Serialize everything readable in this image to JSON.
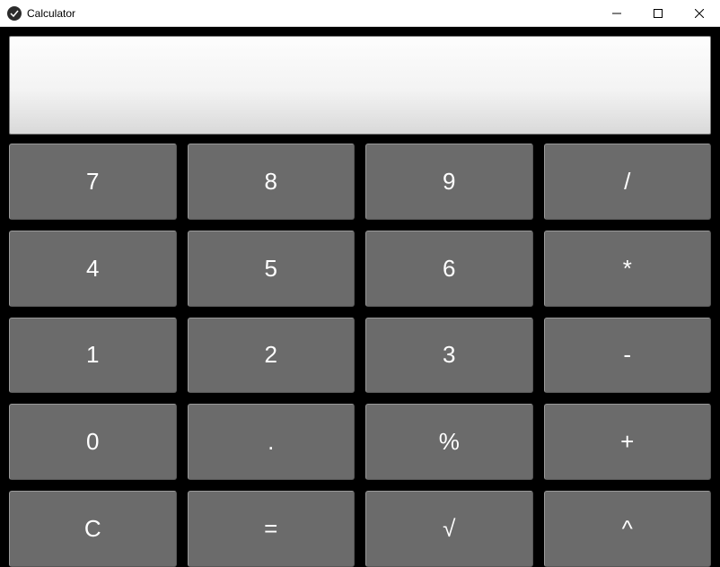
{
  "window": {
    "title": "Calculator"
  },
  "display": {
    "value": ""
  },
  "keys": {
    "r0c0": "7",
    "r0c1": "8",
    "r0c2": "9",
    "r0c3": "/",
    "r1c0": "4",
    "r1c1": "5",
    "r1c2": "6",
    "r1c3": "*",
    "r2c0": "1",
    "r2c1": "2",
    "r2c2": "3",
    "r2c3": "-",
    "r3c0": "0",
    "r3c1": ".",
    "r3c2": "%",
    "r3c3": "+",
    "r4c0": "C",
    "r4c1": "=",
    "r4c2": "√",
    "r4c3": "^"
  }
}
